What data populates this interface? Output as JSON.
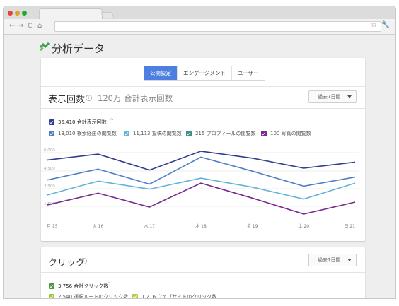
{
  "page": {
    "title": "分析データ",
    "tabs": [
      {
        "label": "公開設定",
        "active": true
      },
      {
        "label": "エンゲージメント",
        "active": false
      },
      {
        "label": "ユーザー",
        "active": false
      }
    ]
  },
  "views_card": {
    "title": "表示回数",
    "subtitle": "120万 合計表示回数",
    "range": "過去7日間",
    "total_legend": "35,410 合計表示回数",
    "legend": [
      {
        "label": "13,010 検索経由の閲覧数",
        "color": "#4f7ec7"
      },
      {
        "label": "11,113 投稿の閲覧数",
        "color": "#62b4d6"
      },
      {
        "label": "215 プロフィールの閲覧数",
        "color": "#3f8f8a"
      },
      {
        "label": "100 写真の閲覧数",
        "color": "#7a2a8e"
      }
    ],
    "total_color": "#2f3f8f"
  },
  "chart_data": {
    "type": "line",
    "x": [
      "月 15",
      "火 16",
      "水 17",
      "木 18",
      "金 19",
      "土 20",
      "日 21"
    ],
    "yticks": [
      "6,000",
      "4,500",
      "3,500",
      "1,500"
    ],
    "series": [
      {
        "name": "35,410 合計表示回数",
        "color": "#2f3f8f",
        "values": [
          5900,
          6500,
          4900,
          6800,
          6100,
          5100,
          5700
        ]
      },
      {
        "name": "13,010 検索経由の閲覧数",
        "color": "#4f7ec7",
        "values": [
          3900,
          5000,
          3500,
          6200,
          4800,
          3300,
          4200
        ]
      },
      {
        "name": "11,113 投稿の閲覧数",
        "color": "#62b4d6",
        "values": [
          2400,
          3800,
          3000,
          4100,
          3200,
          2000,
          3600
        ]
      },
      {
        "name": "100 写真の閲覧数",
        "color": "#7a2a8e",
        "values": [
          1400,
          2600,
          1200,
          3600,
          2100,
          500,
          1700
        ]
      }
    ],
    "ylim": [
      0,
      7500
    ],
    "grid": true
  },
  "clicks_card": {
    "title": "クリック",
    "range": "過去7日間",
    "total_legend": "3,756 合計クリック数",
    "total_color": "#4c9a3f",
    "legend": [
      {
        "label": "2,540 運転ルートのクリック数",
        "color": "#a7c33a"
      },
      {
        "label": "1,216 ウェブサイトのクリック数",
        "color": "#b5cc3c"
      }
    ]
  },
  "browser": {
    "traffic_colors": [
      "#e0443e",
      "#dea123",
      "#1aab29"
    ],
    "nav": [
      "←",
      "→",
      "C",
      "⌂"
    ]
  }
}
